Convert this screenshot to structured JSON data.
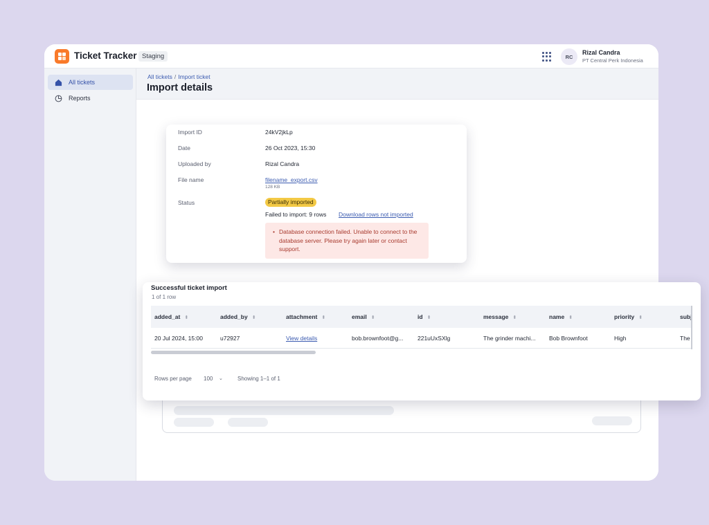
{
  "app": {
    "title": "Ticket Tracker",
    "environment": "Staging"
  },
  "user": {
    "initials": "RC",
    "name": "Rizal Candra",
    "organization": "PT Central Perk Indonesia"
  },
  "sidebar": {
    "items": [
      {
        "label": "All tickets",
        "icon": "home-icon",
        "active": true
      },
      {
        "label": "Reports",
        "icon": "pie-chart-icon",
        "active": false
      }
    ]
  },
  "breadcrumb": {
    "parent": "All tickets",
    "separator": "/",
    "current": "Import ticket"
  },
  "page": {
    "title": "Import details"
  },
  "details": {
    "import_id_label": "Import ID",
    "import_id": "24kV2jkLp",
    "date_label": "Date",
    "date": "26 Oct 2023, 15:30",
    "uploaded_by_label": "Uploaded by",
    "uploaded_by": "Rizal Candra",
    "file_name_label": "File name",
    "file_name": "filename_export.csv",
    "file_size": "128 KB",
    "status_label": "Status",
    "status": "Partially imported",
    "failed_text": "Failed to import: 9 rows",
    "download_link": "Download rows not imported",
    "error_bullet": "•",
    "error_message": "Database connection failed. Unable to connect to the database server. Please try again later or contact support."
  },
  "import_table": {
    "title": "Successful ticket import",
    "count": "1 of 1 row",
    "columns": [
      "added_at",
      "added_by",
      "attachment",
      "email",
      "id",
      "message",
      "name",
      "priority",
      "subj"
    ],
    "sort_glyph": "⬍",
    "rows": [
      [
        "20 Jul 2024, 15:00",
        "u72927",
        "View details",
        "bob.brownfoot@g...",
        "221uUxSXlg",
        "The grinder machi...",
        "Bob Brownfoot",
        "High",
        "The"
      ]
    ],
    "rows_per_page_label": "Rows per page",
    "rows_per_page": "100",
    "showing": "Showing 1–1 of 1"
  },
  "colors": {
    "accent": "#3b5bb0",
    "logo": "#f97a2a",
    "status_pill": "#f3c945",
    "error_bg": "#fde8e6",
    "error_text": "#a83a2e",
    "background": "#dcd7ee"
  }
}
